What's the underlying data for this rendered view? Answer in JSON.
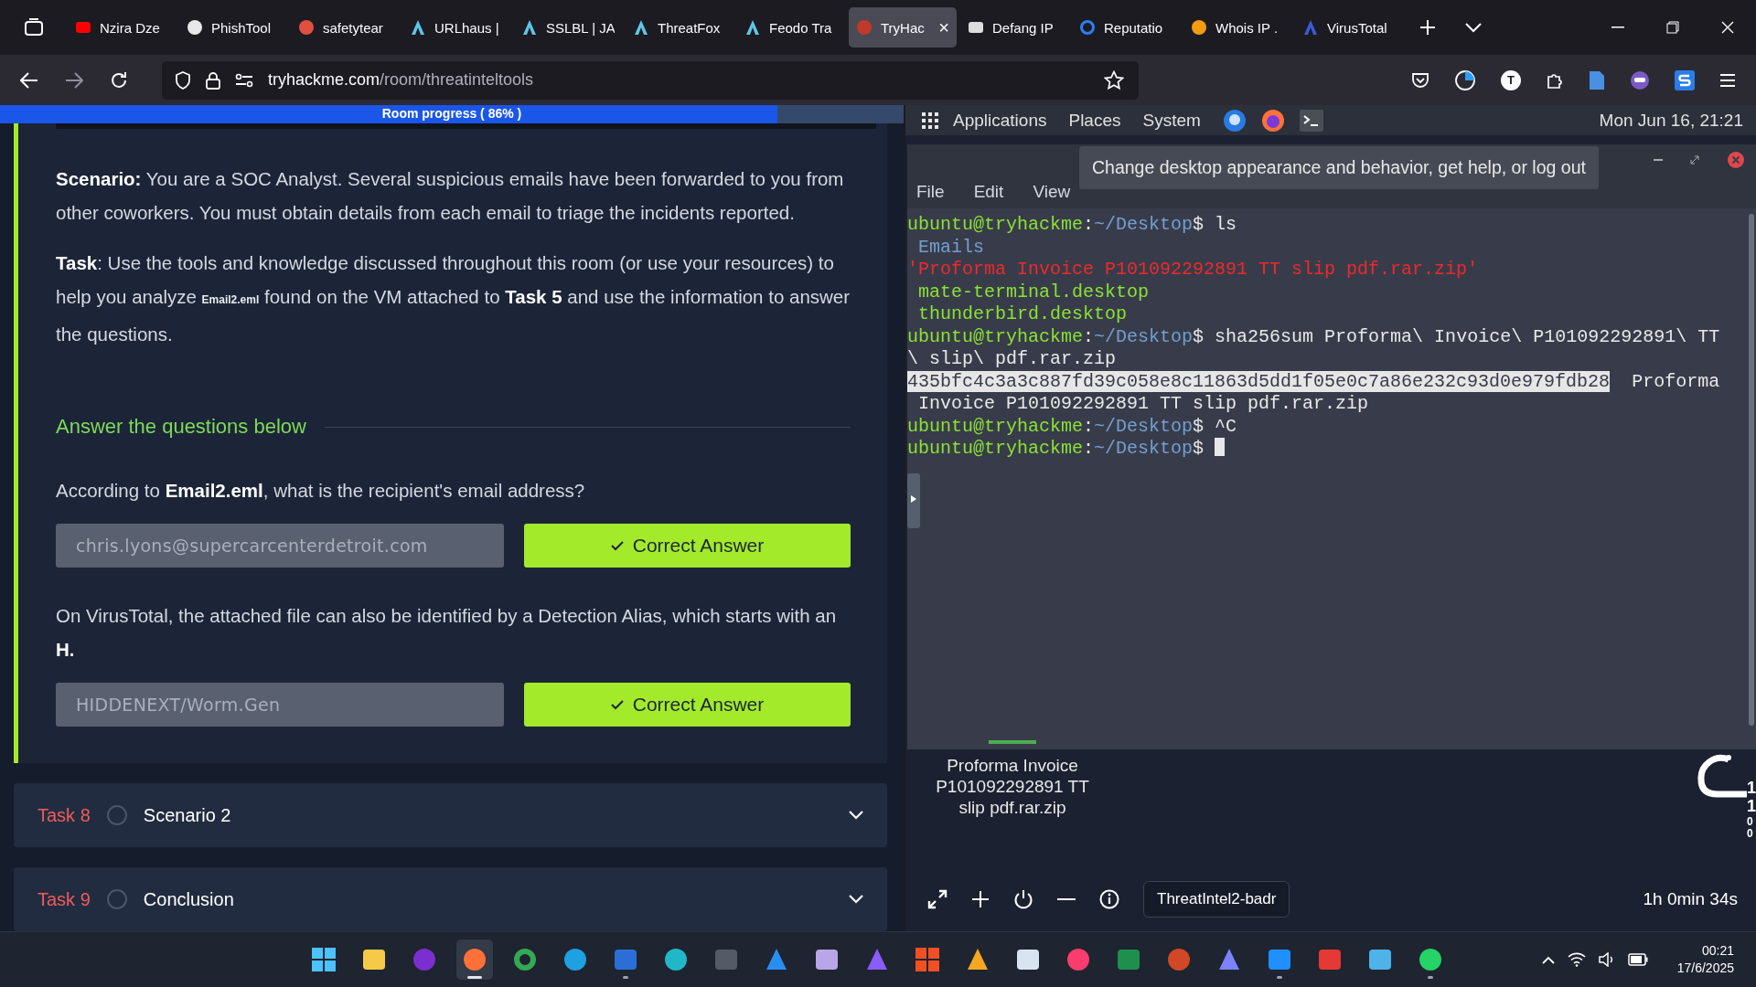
{
  "browser": {
    "tabs": [
      {
        "title": "Nzira Dze",
        "selected": false
      },
      {
        "title": "PhishTool",
        "selected": false
      },
      {
        "title": "safetytear",
        "selected": false
      },
      {
        "title": "URLhaus |",
        "selected": false
      },
      {
        "title": "SSLBL | JA",
        "selected": false
      },
      {
        "title": "ThreatFox",
        "selected": false
      },
      {
        "title": "Feodo Tra",
        "selected": false
      },
      {
        "title": "TryHac",
        "selected": true
      },
      {
        "title": "Defang IP",
        "selected": false
      },
      {
        "title": "Reputatio",
        "selected": false
      },
      {
        "title": "Whois IP .",
        "selected": false
      },
      {
        "title": "VirusTotal",
        "selected": false
      }
    ],
    "close_tab": "×",
    "address": {
      "domain": "tryhackme.com",
      "path": "/room/threatinteltools"
    },
    "avatar_letter": "T"
  },
  "room": {
    "progress": {
      "label": "Room progress ( 86% )",
      "level": 0.86
    },
    "scenario": "**Scenario:** You are a SOC Analyst. Several suspicious emails have been forwarded to you from other coworkers. You must obtain details from each email to triage the incidents reported.",
    "task_text": {
      "lead": "**Task**: Use the tools and knowledge discussed throughout this room (or use your resources) to help you analyze",
      "file": "Email2.eml",
      "rest": "found on the VM attached to **Task 5** and use the information to answer the questions."
    },
    "answers_heading": "Answer the questions below",
    "questions": [
      {
        "text": "According to **Email2.eml**, what is the recipient's email address?",
        "answer": "chris.lyons@supercarcenterdetroit.com",
        "button": "Correct Answer",
        "correct": true
      },
      {
        "text": "On VirusTotal, the attached file can also be identified by a Detection Alias, which starts with an **H.**",
        "answer": "HIDDENEXT/Worm.Gen",
        "button": "Correct Answer",
        "correct": true
      }
    ],
    "tasks": [
      {
        "number": "Task 8",
        "title": "Scenario 2",
        "completed": false
      },
      {
        "number": "Task 9",
        "title": "Conclusion",
        "completed": false
      }
    ]
  },
  "vm": {
    "panel": {
      "menus": [
        "Applications",
        "Places",
        "System"
      ],
      "clock": "Mon Jun 16, 21:21"
    },
    "tooltip": "Change desktop appearance and behavior, get help, or log out",
    "terminal": {
      "menus": [
        "File",
        "Edit",
        "View"
      ],
      "lines": [
        [
          {
            "kind": "user",
            "text": "ubuntu@tryhackme"
          },
          {
            "kind": "plain",
            "text": ":"
          },
          {
            "kind": "path",
            "text": "~/Desktop"
          },
          {
            "kind": "plain",
            "text": "$ ls"
          }
        ],
        [
          {
            "kind": "directory",
            "text": " Emails"
          }
        ],
        [
          {
            "kind": "archive",
            "text": "'Proforma Invoice P101092292891 TT slip pdf.rar.zip'"
          }
        ],
        [
          {
            "kind": "executable",
            "text": " mate-terminal.desktop"
          }
        ],
        [
          {
            "kind": "executable",
            "text": " thunderbird.desktop"
          }
        ],
        [
          {
            "kind": "user",
            "text": "ubuntu@tryhackme"
          },
          {
            "kind": "plain",
            "text": ":"
          },
          {
            "kind": "path",
            "text": "~/Desktop"
          },
          {
            "kind": "plain",
            "text": "$ sha256sum Proforma\\ Invoice\\ P101092292891\\ TT"
          }
        ],
        [
          {
            "kind": "plain",
            "text": "\\ slip\\ pdf.rar.zip"
          }
        ],
        [
          {
            "kind": "selection",
            "text": "435bfc4c3a3c887fd39c058e8c11863d5dd1f05e0c7a86e232c93d0e979fdb28"
          },
          {
            "kind": "plain",
            "text": "  Proforma"
          }
        ],
        [
          {
            "kind": "plain",
            "text": " Invoice P101092292891 TT slip pdf.rar.zip"
          }
        ],
        [
          {
            "kind": "user",
            "text": "ubuntu@tryhackme"
          },
          {
            "kind": "plain",
            "text": ":"
          },
          {
            "kind": "path",
            "text": "~/Desktop"
          },
          {
            "kind": "plain",
            "text": "$ ^C"
          }
        ],
        [
          {
            "kind": "user",
            "text": "ubuntu@tryhackme"
          },
          {
            "kind": "plain",
            "text": ":"
          },
          {
            "kind": "path",
            "text": "~/Desktop"
          },
          {
            "kind": "plain",
            "text": "$ "
          }
        ]
      ],
      "cursor": true
    },
    "desktop_file": "Proforma Invoice P101092292891 TT slip pdf.rar.zip",
    "widget_digits": [
      "1",
      "1",
      "0",
      "0"
    ],
    "machine_name": "ThreatIntel2-badr",
    "timer": "1h 0min 34s"
  },
  "taskbar": {
    "apps": [
      {
        "running": false,
        "selected": false
      },
      {
        "running": false,
        "selected": false
      },
      {
        "running": false,
        "selected": false
      },
      {
        "running": true,
        "selected": true
      },
      {
        "running": false,
        "selected": false
      },
      {
        "running": false,
        "selected": false
      },
      {
        "running": true,
        "selected": false
      },
      {
        "running": false,
        "selected": false
      },
      {
        "running": false,
        "selected": false
      },
      {
        "running": false,
        "selected": false
      },
      {
        "running": false,
        "selected": false
      },
      {
        "running": false,
        "selected": false
      },
      {
        "running": false,
        "selected": false
      },
      {
        "running": false,
        "selected": false
      },
      {
        "running": false,
        "selected": false
      },
      {
        "running": false,
        "selected": false
      },
      {
        "running": false,
        "selected": false
      },
      {
        "running": false,
        "selected": false
      },
      {
        "running": false,
        "selected": false
      },
      {
        "running": true,
        "selected": false
      },
      {
        "running": false,
        "selected": false
      },
      {
        "running": false,
        "selected": false
      },
      {
        "running": true,
        "selected": false
      }
    ],
    "time": "00:21",
    "date": "17/6/2025"
  }
}
